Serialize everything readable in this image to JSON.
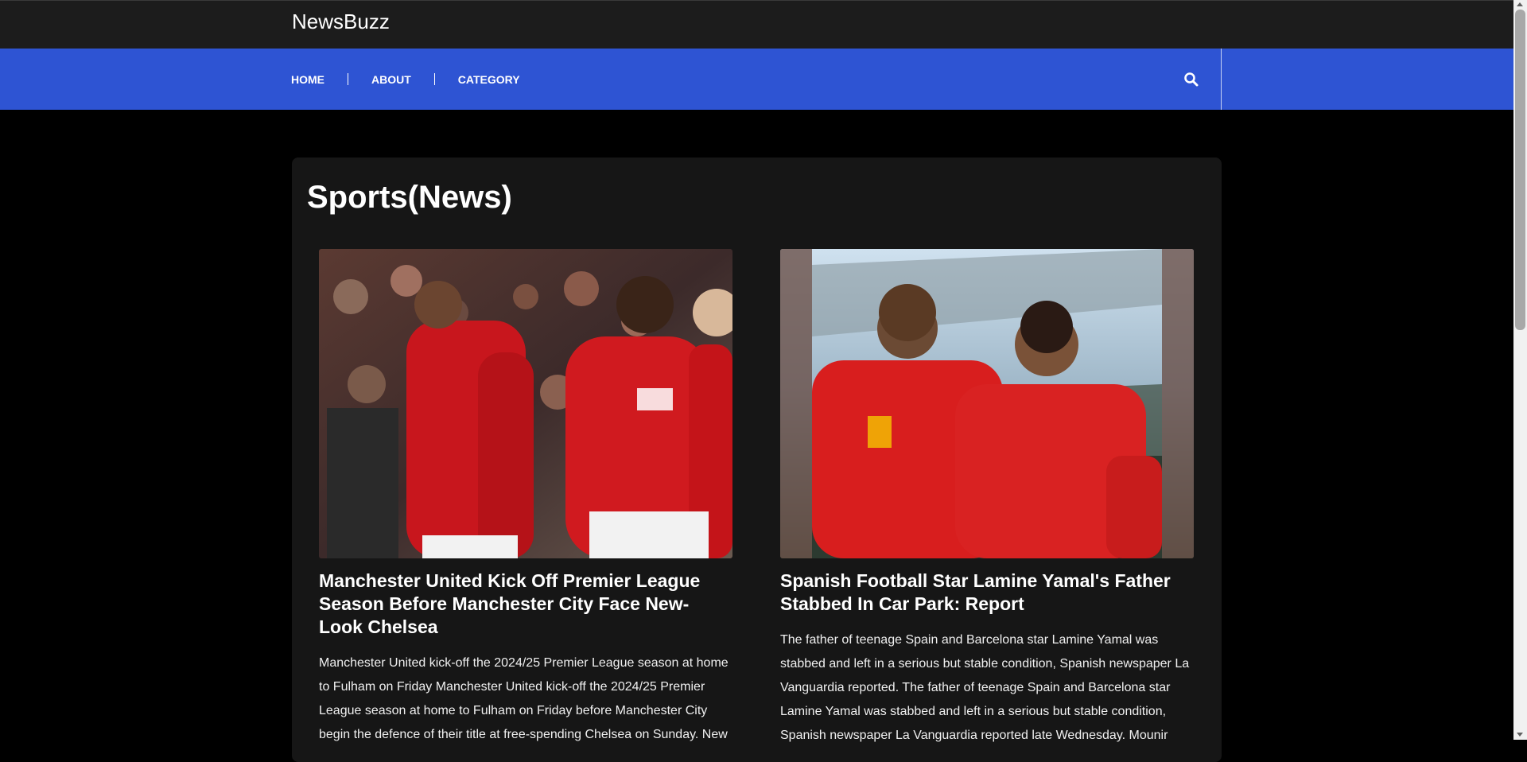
{
  "site": {
    "brand": "NewsBuzz"
  },
  "nav": {
    "items": [
      {
        "label": "HOME"
      },
      {
        "label": "ABOUT"
      },
      {
        "label": "CATEGORY"
      }
    ],
    "search_icon": "search-icon"
  },
  "main": {
    "section_title": "Sports(News)",
    "articles": [
      {
        "image": "manchester-united-players-photo",
        "title": "Manchester United Kick Off Premier League Season Before Manchester City Face New-Look Chelsea",
        "excerpt": "Manchester United kick-off the 2024/25 Premier League season at home to Fulham on Friday Manchester United kick-off the 2024/25 Premier League season at home to Fulham on Friday before Manchester City begin the defence of their title at free-spending Chelsea on Sunday. New"
      },
      {
        "image": "lamine-yamal-and-father-photo",
        "title": "Spanish Football Star Lamine Yamal's Father Stabbed In Car Park: Report",
        "excerpt": "The father of teenage Spain and Barcelona star Lamine Yamal was stabbed and left in a serious but stable condition, Spanish newspaper La Vanguardia reported. The father of teenage Spain and Barcelona star Lamine Yamal was stabbed and left in a serious but stable condition, Spanish newspaper La Vanguardia reported late Wednesday. Mounir"
      }
    ]
  },
  "colors": {
    "topbar": "#1c1c1c",
    "navbar": "#2e54d3",
    "page_bg": "#000000",
    "panel_bg": "#161616",
    "text": "#ffffff"
  }
}
